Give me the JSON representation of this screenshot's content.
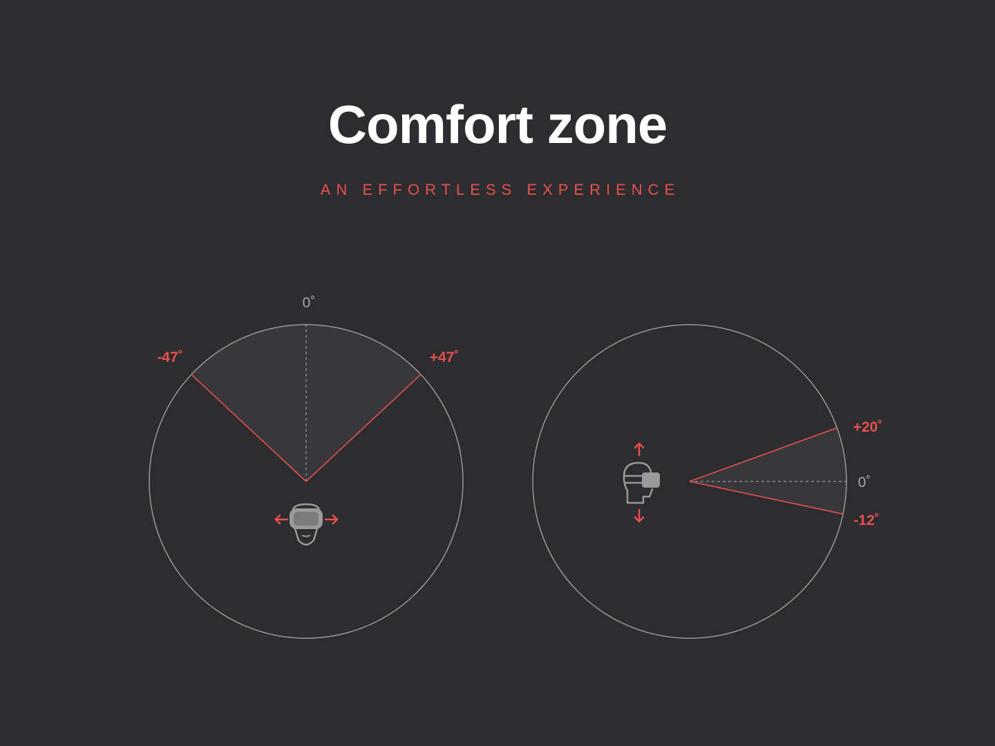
{
  "header": {
    "title": "Comfort zone",
    "subtitle": "AN EFFORTLESS EXPERIENCE"
  },
  "colors": {
    "background": "#2d2d2f",
    "accent": "#e8504f",
    "circle_stroke": "#9a9a9a",
    "zone_fill": "#38383a",
    "icon": "#9a9a9a"
  },
  "horizontal_diagram": {
    "center_label": "0˚",
    "left_label": "-47˚",
    "right_label": "+47˚",
    "min_angle_deg": -47,
    "max_angle_deg": 47,
    "icon": "vr-headset-front-icon",
    "arrows": [
      "arrow-left-icon",
      "arrow-right-icon"
    ]
  },
  "vertical_diagram": {
    "center_label": "0˚",
    "upper_label": "+20˚",
    "lower_label": "-12˚",
    "min_angle_deg": -12,
    "max_angle_deg": 20,
    "icon": "vr-headset-side-icon",
    "arrows": [
      "arrow-up-icon",
      "arrow-down-icon"
    ]
  }
}
